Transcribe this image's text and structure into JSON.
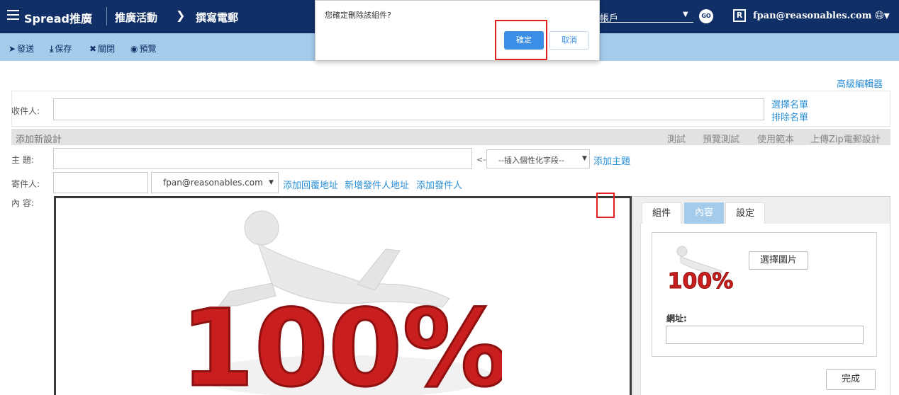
{
  "topbar": {
    "brand": "Spread推廣",
    "crumb1": "推廣活動",
    "crumb_arrow": "❯",
    "crumb2": "撰寫電郵",
    "account_select": "帳戶",
    "go_label": "GO",
    "r_badge": "R",
    "user_email": "fpan@reasonables.com"
  },
  "toolbar": {
    "send": "發送",
    "save": "保存",
    "close": "關閉",
    "preview": "預覽"
  },
  "dialog": {
    "message": "您確定刪除該組件?",
    "confirm": "確定",
    "cancel": "取消"
  },
  "advanced_editor": "高級編輯器",
  "recipients": {
    "label": "收件人:",
    "select_list": "選擇名單",
    "exclude_list": "排除名單"
  },
  "design_bar": {
    "add_new": "添加新設計",
    "test": "測試",
    "preview_test": "預覽測試",
    "use_template": "使用範本",
    "upload_zip": "上傳Zip電郵設計"
  },
  "subject": {
    "label": "主  題:",
    "arrow": "<--",
    "personalize_select": "--插入個性化字段--",
    "add_subject": "添加主題"
  },
  "sender": {
    "label": "寄件人:",
    "email_select": "fpan@reasonables.com",
    "add_reply": "添加回覆地址",
    "add_sender_addr": "新增發件人地址",
    "add_sender": "添加發件人"
  },
  "content": {
    "label": "內  容:",
    "image_text": "100%"
  },
  "panel": {
    "tabs": [
      "組件",
      "內容",
      "設定"
    ],
    "active_tab": 1,
    "choose_image": "選擇圖片",
    "thumb_text": "100%",
    "url_label": "網址:",
    "url_value": "",
    "done": "完成"
  },
  "colors": {
    "topbar": "#0f2f66",
    "toolbar": "#a4cbea",
    "link": "#2a8fd6",
    "confirm": "#3a8ee6",
    "highlight": "#e02020"
  }
}
